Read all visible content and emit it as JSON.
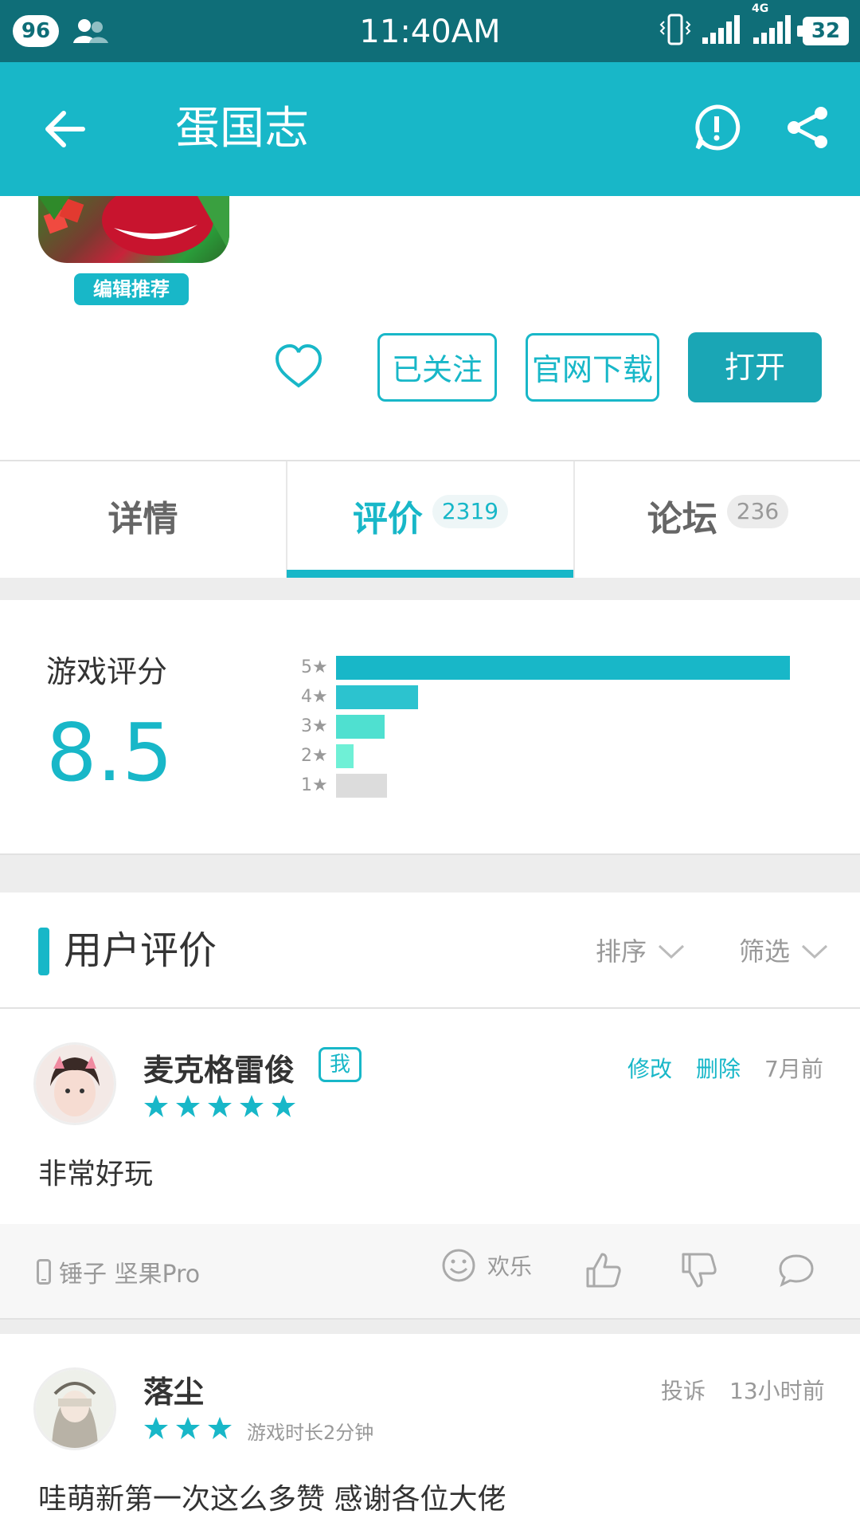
{
  "status_bar": {
    "notification_count": "96",
    "time": "11:40AM",
    "network_label": "4G",
    "battery": "32"
  },
  "app_bar": {
    "title": "蛋国志"
  },
  "app_header": {
    "editor_badge": "编辑推荐",
    "followed_button": "已关注",
    "official_download_button": "官网下载",
    "open_button": "打开"
  },
  "tabs": [
    {
      "label": "详情",
      "count": ""
    },
    {
      "label": "评价",
      "count": "2319"
    },
    {
      "label": "论坛",
      "count": "236"
    }
  ],
  "rating": {
    "title": "游戏评分",
    "score": "8.5",
    "distribution": [
      {
        "label": "5",
        "fraction": 1.0,
        "color": "#18b7c8"
      },
      {
        "label": "4",
        "fraction": 0.18,
        "color": "#2cc3cf"
      },
      {
        "label": "3",
        "fraction": 0.107,
        "color": "#4fe0d0"
      },
      {
        "label": "2",
        "fraction": 0.038,
        "color": "#6ff0d6"
      },
      {
        "label": "1",
        "fraction": 0.112,
        "color": "#dcdcdc"
      }
    ]
  },
  "reviews_section": {
    "title": "用户评价",
    "sort_label": "排序",
    "filter_label": "筛选"
  },
  "reviews": [
    {
      "name": "麦克格雷俊",
      "me_tag": "我",
      "stars": 5,
      "edit_label": "修改",
      "delete_label": "删除",
      "time": "7月前",
      "body": "非常好玩",
      "device": "锤子 坚果Pro",
      "mood": "欢乐"
    },
    {
      "name": "落尘",
      "stars": 3,
      "playtime": "游戏时长2分钟",
      "report_label": "投诉",
      "time": "13小时前",
      "body": "哇萌新第一次这么多赞 感谢各位大佬"
    }
  ],
  "colors": {
    "accent": "#18b7c8",
    "status_bar": "#0f6e78",
    "open_button": "#1aa6b5"
  }
}
